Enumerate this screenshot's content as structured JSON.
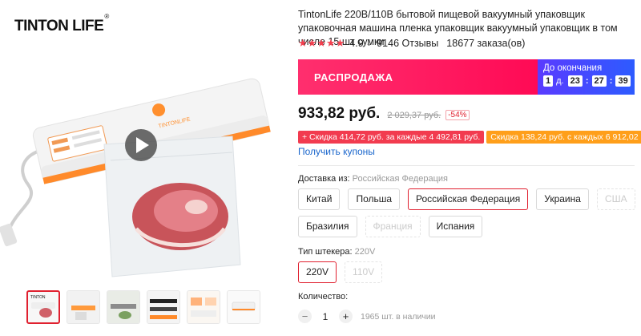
{
  "brand": {
    "name": "TINTON LIFE",
    "mark": "®"
  },
  "product": {
    "title": "TintonLife 220В/110В бытовой пищевой вакуумный упаковщик упаковочная машина пленка упаковщик вакуумный упаковщик в том числе 15 шт сумки",
    "rating": "4.9",
    "reviews": "9146 Отзывы",
    "orders": "18677 заказа(ов)",
    "stars": "★★★★★"
  },
  "sale": {
    "label": "РАСПРОДАЖА",
    "countdown_label": "До окончания",
    "days": "1",
    "days_unit": "д.",
    "hours": "23",
    "minutes": "27",
    "seconds": "39"
  },
  "price": {
    "current": "933,82 руб.",
    "old": "2 029,37 руб.",
    "discount": "-54%"
  },
  "coupons": {
    "red": "+ Скидка 414,72 руб. за каждые 4 492,81 руб.",
    "orange": "Скидка 138,24 руб. с каждых 6 912,02 руб.",
    "get_label": "Получить купоны"
  },
  "shipping": {
    "label": "Доставка из:",
    "value": "Российская Федерация",
    "options_row1": [
      "Китай",
      "Польша",
      "Российская Федерация",
      "Украина",
      "США"
    ],
    "options_row2": [
      "Бразилия",
      "Франция",
      "Испания"
    ]
  },
  "plug": {
    "label": "Тип штекера:",
    "value": "220V",
    "options": [
      "220V",
      "110V"
    ]
  },
  "quantity": {
    "label": "Количество:",
    "value": "1",
    "minus": "−",
    "plus": "+",
    "stock": "1965 шт. в наличии"
  },
  "colors": {
    "accent": "#e0202f",
    "sale_pink": "#ff0a55",
    "timer_blue": "#2d5bff",
    "coupon_orange": "#ff9f1a",
    "link_blue": "#1a66cc"
  },
  "icons": {
    "play": "play-icon",
    "chevron": "chevron-down-icon",
    "star": "star-icon"
  }
}
